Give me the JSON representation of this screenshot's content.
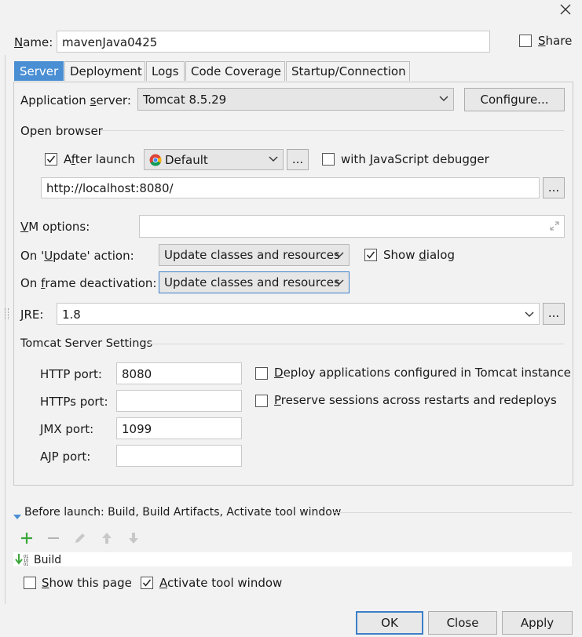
{
  "dialog": {
    "name_label": "Name:",
    "name_value": "mavenJava0425",
    "share_label": "Share",
    "share_checked": false,
    "close_icon": "close-icon"
  },
  "tabs": [
    {
      "label": "Server",
      "active": true
    },
    {
      "label": "Deployment",
      "active": false
    },
    {
      "label": "Logs",
      "active": false
    },
    {
      "label": "Code Coverage",
      "active": false
    },
    {
      "label": "Startup/Connection",
      "active": false
    }
  ],
  "server": {
    "app_server_label": "Application server:",
    "app_server_value": "Tomcat 8.5.29",
    "configure_label": "Configure...",
    "open_browser_label": "Open browser",
    "after_launch_label": "After launch",
    "after_launch_checked": true,
    "browser_value": "Default",
    "browser_icon": "chrome-icon",
    "ellipsis": "...",
    "js_debugger_label": "with JavaScript debugger",
    "js_debugger_checked": false,
    "url_value": "http://localhost:8080/",
    "vm_options_label": "VM options:",
    "vm_options_value": "",
    "on_update_label": "On 'Update' action:",
    "on_update_value": "Update classes and resources",
    "show_dialog_label": "Show dialog",
    "show_dialog_checked": true,
    "on_frame_label": "On frame deactivation:",
    "on_frame_value": "Update classes and resources",
    "jre_label": "JRE:",
    "jre_value": "1.8",
    "tomcat_settings_label": "Tomcat Server Settings",
    "http_port_label": "HTTP port:",
    "http_port_value": "8080",
    "https_port_label": "HTTPs port:",
    "https_port_value": "",
    "jmx_port_label": "JMX port:",
    "jmx_port_value": "1099",
    "ajp_port_label": "AJP port:",
    "ajp_port_value": "",
    "deploy_apps_label": "Deploy applications configured in Tomcat instance",
    "deploy_apps_checked": false,
    "preserve_sessions_label": "Preserve sessions across restarts and redeploys",
    "preserve_sessions_checked": false
  },
  "before_launch": {
    "header": "Before launch: Build, Build Artifacts, Activate tool window",
    "tools": [
      "add-icon",
      "remove-icon",
      "edit-icon",
      "move-up-icon",
      "move-down-icon"
    ],
    "items": [
      {
        "label": "Build",
        "icon": "build-icon"
      }
    ],
    "show_page_label": "Show this page",
    "show_page_checked": false,
    "activate_tool_label": "Activate tool window",
    "activate_tool_checked": true
  },
  "footer": {
    "ok_label": "OK",
    "close_label": "Close",
    "apply_label": "Apply"
  },
  "colors": {
    "accent": "#4a8fd4",
    "add_green": "#3aa63a"
  }
}
